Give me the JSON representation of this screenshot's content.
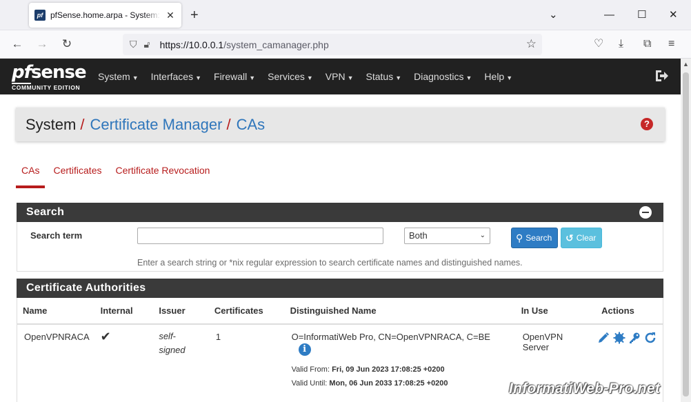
{
  "browser": {
    "tab_title": "pfSense.home.arpa - System: Certificate Manager: CAs",
    "favicon_text": "pf",
    "new_tab": "+",
    "url_host": "https://10.0.0.1",
    "url_path": "/system_camanager.php"
  },
  "pfsense": {
    "logo_word_pf": "pf",
    "logo_word_sense": "sense",
    "logo_edition": "COMMUNITY EDITION",
    "menu": [
      "System",
      "Interfaces",
      "Firewall",
      "Services",
      "VPN",
      "Status",
      "Diagnostics",
      "Help"
    ]
  },
  "breadcrumb": {
    "system": "System",
    "sep": "/",
    "cert_manager": "Certificate Manager",
    "cas": "CAs",
    "help": "?"
  },
  "tabs": [
    "CAs",
    "Certificates",
    "Certificate Revocation"
  ],
  "search_panel": {
    "title": "Search",
    "term_label": "Search term",
    "term_value": "",
    "scope_selected": "Both",
    "search_button": "Search",
    "clear_button": "Clear",
    "help_text": "Enter a search string or *nix regular expression to search certificate names and distinguished names."
  },
  "ca_panel": {
    "title": "Certificate Authorities",
    "columns": [
      "Name",
      "Internal",
      "Issuer",
      "Certificates",
      "Distinguished Name",
      "In Use",
      "Actions"
    ],
    "rows": [
      {
        "name": "OpenVPNRACA",
        "internal": "✔",
        "issuer_line1": "self-",
        "issuer_line2": "signed",
        "certificates": "1",
        "dn": "O=InformatiWeb Pro, CN=OpenVPNRACA, C=BE",
        "valid_from_label": "Valid From:",
        "valid_from": "Fri, 09 Jun 2023 17:08:25 +0200",
        "valid_until_label": "Valid Until:",
        "valid_until": "Mon, 06 Jun 2033 17:08:25 +0200",
        "in_use": "OpenVPN Server"
      }
    ]
  },
  "watermark": "InformatiWeb-Pro.net",
  "colors": {
    "pf_nav": "#212121",
    "accent_red": "#b71c1c",
    "link_blue": "#2f76bb",
    "panel_head": "#3a3a3a",
    "btn_search": "#2e7cc4",
    "btn_clear": "#5bc0de"
  }
}
